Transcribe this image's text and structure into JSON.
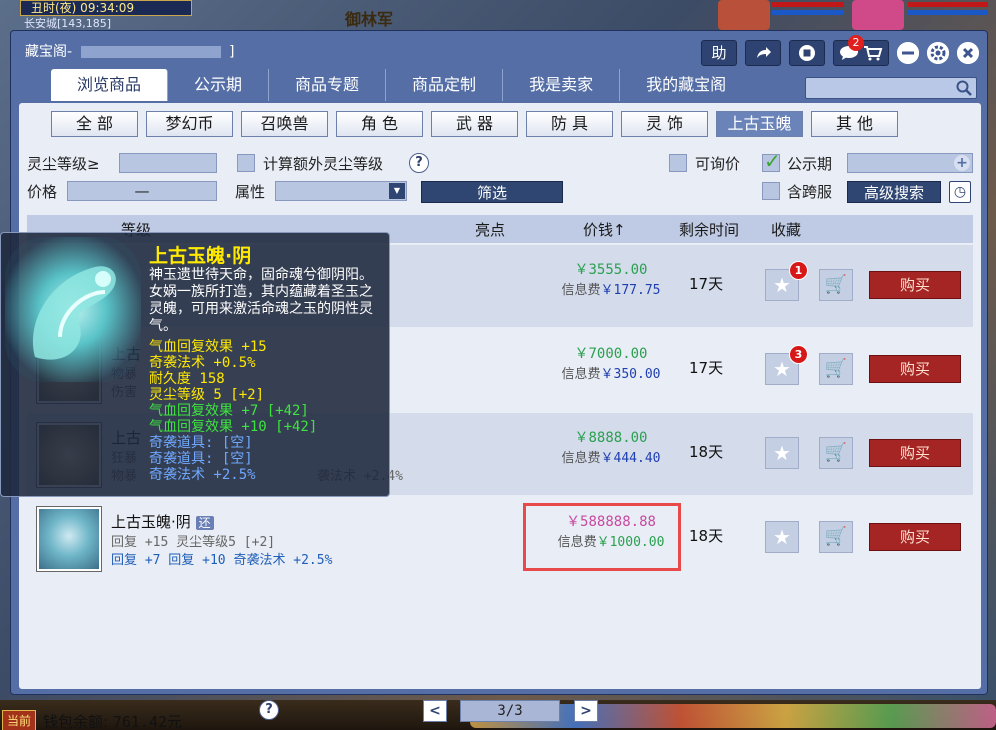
{
  "game": {
    "time_label": "丑时(夜) 09:34:09",
    "location": "长安城[143,185]",
    "npc_label": "御林军",
    "bottom_label": "当前"
  },
  "window": {
    "title": "藏宝阁-",
    "title_tail": "]",
    "help_btn": "助",
    "msg_count": "2",
    "tabs": [
      "浏览商品",
      "公示期",
      "商品专题",
      "商品定制",
      "我是卖家",
      "我的藏宝阁"
    ],
    "active_tab": 0,
    "search_placeholder": ""
  },
  "categories": {
    "items": [
      "全 部",
      "梦幻币",
      "召唤兽",
      "角 色",
      "武 器",
      "防 具",
      "灵 饰",
      "上古玉魄",
      "其 他"
    ],
    "active": 7
  },
  "filters": {
    "dust_level_label": "灵尘等级≥",
    "calc_extra_label": "计算额外灵尘等级",
    "inquiry_label": "可询价",
    "publicity_label": "公示期",
    "price_label": "价格",
    "price_sep": "—",
    "attr_label": "属性",
    "filter_btn": "筛选",
    "cross_server_label": "含跨服",
    "advanced_btn": "高级搜索"
  },
  "table": {
    "headers": [
      "等级",
      "亮点",
      "价钱",
      "剩余时间",
      "收藏"
    ],
    "price_sort_arrow": "↑",
    "fee_label": "信息费",
    "buy_label": "购买",
    "rows": [
      {
        "price": "￥3555.00",
        "fee": "￥177.75",
        "time": "17天",
        "fav": "1"
      },
      {
        "price": "￥7000.00",
        "fee": "￥350.00",
        "time": "17天",
        "fav": "3"
      },
      {
        "price": "￥8888.00",
        "fee": "￥444.40",
        "time": "18天",
        "fav": ""
      },
      {
        "price": "￥588888.88",
        "fee": "￥1000.00",
        "time": "18天",
        "fav": "",
        "name": "上古玉魄·阴",
        "tag": "还",
        "sub1": "回复 +15 灵尘等级5 [+2]",
        "sub2": "回复 +7 回复 +10 奇袭法术 +2.5%"
      }
    ],
    "row3_partial": {
      "name": "上古",
      "sub1": "狂暴",
      "sub2": "物暴",
      "tail": "袭法术 +2.4%"
    },
    "row2_partial": {
      "name": "上古",
      "sub1": "物暴",
      "sub2": "伤害"
    }
  },
  "footer": {
    "wallet_label": "钱包余额:",
    "wallet_value": "761.42元",
    "page": "3/3",
    "prev": "<",
    "next": ">"
  },
  "tooltip": {
    "title": "上古玉魄·阴",
    "desc": "神玉遗世待天命，固命魂兮御阴阳。女娲一族所打造，其内蕴藏着圣玉之灵魄，可用来激活命魂之玉的阴性灵气。",
    "lines": [
      {
        "text": "气血回复效果 +15",
        "color": "#ffe800"
      },
      {
        "text": "奇袭法术 +0.5%",
        "color": "#ffe800"
      },
      {
        "text": "耐久度 158",
        "color": "#ffe800"
      },
      {
        "text": "灵尘等级 5 [+2]",
        "color": "#ffe800"
      },
      {
        "text": "气血回复效果 +7 [+42]",
        "color": "#3ee43e"
      },
      {
        "text": "气血回复效果 +10 [+42]",
        "color": "#3ee43e"
      },
      {
        "text": "奇袭道具: [空]",
        "color": "#6fa8ff"
      },
      {
        "text": "奇袭道具: [空]",
        "color": "#6fa8ff"
      },
      {
        "text": "奇袭法术 +2.5%",
        "color": "#6fa8ff"
      }
    ]
  }
}
